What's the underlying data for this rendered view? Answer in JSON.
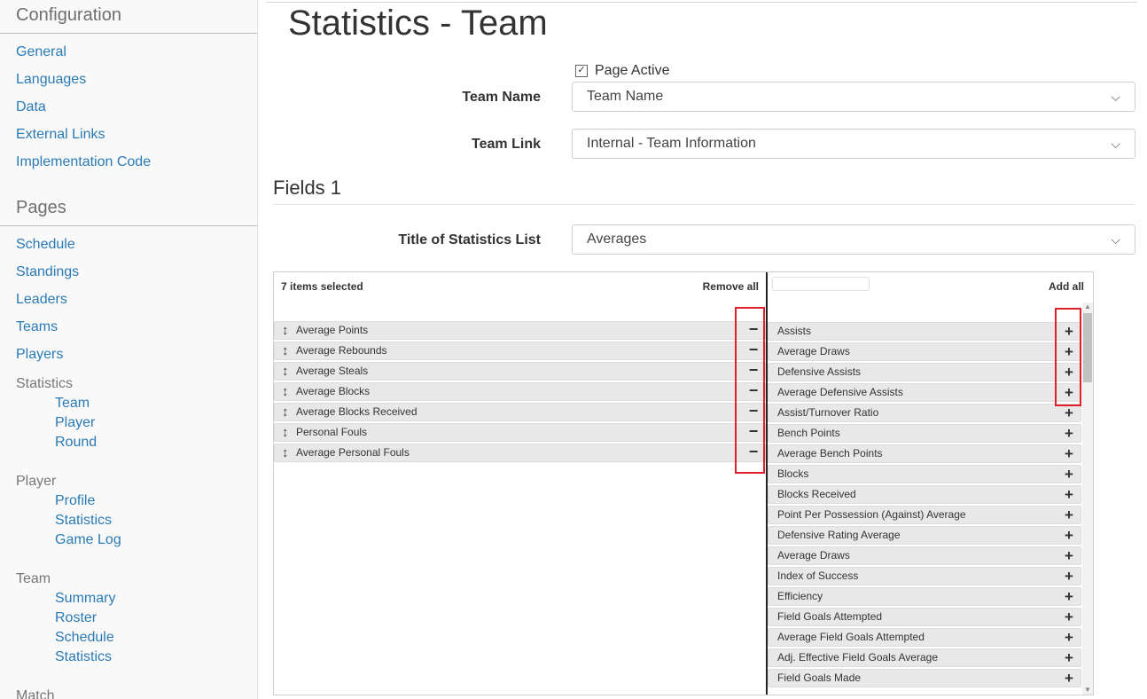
{
  "sidebar": {
    "configuration_title": "Configuration",
    "configuration_links": [
      "General",
      "Languages",
      "Data",
      "External Links",
      "Implementation Code"
    ],
    "pages_title": "Pages",
    "pages_links": [
      "Schedule",
      "Standings",
      "Leaders",
      "Teams",
      "Players"
    ],
    "statistics_group": "Statistics",
    "statistics_links": [
      "Team",
      "Player",
      "Round"
    ],
    "player_group": "Player",
    "player_links": [
      "Profile",
      "Statistics",
      "Game Log"
    ],
    "team_group": "Team",
    "team_links": [
      "Summary",
      "Roster",
      "Schedule",
      "Statistics"
    ],
    "match_group": "Match"
  },
  "page": {
    "title": "Statistics - Team",
    "page_active_label": "Page Active",
    "page_active_checked": true,
    "team_name_label": "Team Name",
    "team_name_value": "Team Name",
    "team_link_label": "Team Link",
    "team_link_value": "Internal - Team Information",
    "fields_title": "Fields 1",
    "stats_list_label": "Title of Statistics List",
    "stats_list_value": "Averages"
  },
  "dual_list": {
    "selected_count": "7 items selected",
    "remove_all": "Remove all",
    "add_all": "Add all",
    "selected": [
      "Average Points",
      "Average Rebounds",
      "Average Steals",
      "Average Blocks",
      "Average Blocks Received",
      "Personal Fouls",
      "Average Personal Fouls"
    ],
    "available": [
      "Assists",
      "Average Draws",
      "Defensive Assists",
      "Average Defensive Assists",
      "Assist/Turnover Ratio",
      "Bench Points",
      "Average Bench Points",
      "Blocks",
      "Blocks Received",
      "Point Per Possession (Against) Average",
      "Defensive Rating Average",
      "Average Draws",
      "Index of Success",
      "Efficiency",
      "Field Goals Attempted",
      "Average Field Goals Attempted",
      "Adj. Effective Field Goals Average",
      "Field Goals Made"
    ]
  },
  "icons": {
    "drag": "↕",
    "minus": "−",
    "plus": "+",
    "chevron": "⌵",
    "check": "✓"
  },
  "colors": {
    "link": "#2a7ab5",
    "highlight": "#e0202a"
  }
}
